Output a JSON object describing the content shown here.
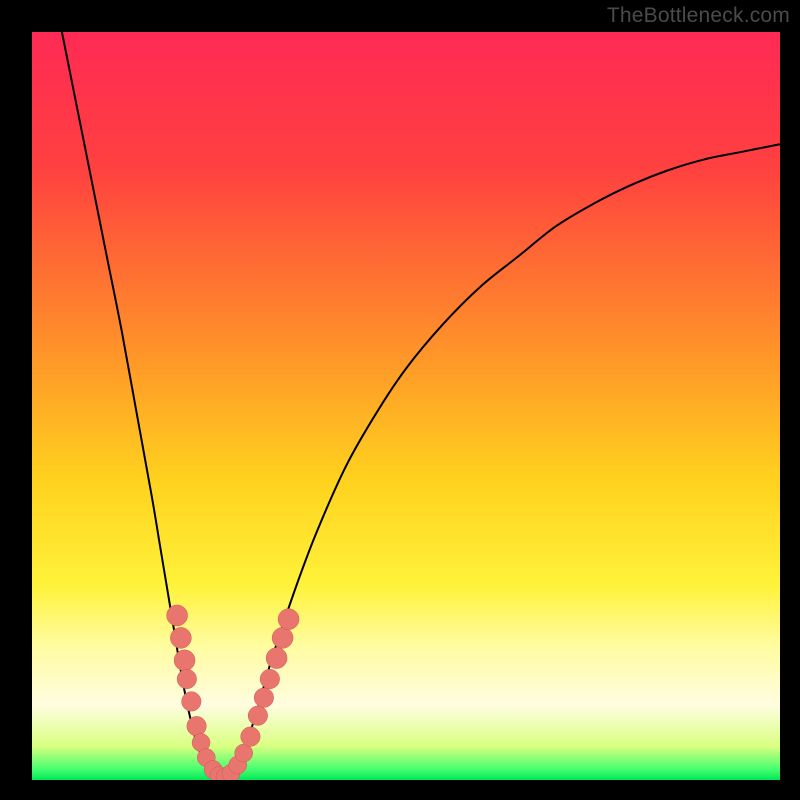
{
  "watermark": "TheBottleneck.com",
  "colors": {
    "frame": "#000000",
    "gradient_stops": [
      {
        "offset": 0.0,
        "color": "#ff2a55"
      },
      {
        "offset": 0.18,
        "color": "#ff4040"
      },
      {
        "offset": 0.4,
        "color": "#ff8a2b"
      },
      {
        "offset": 0.6,
        "color": "#ffd21e"
      },
      {
        "offset": 0.74,
        "color": "#fff23a"
      },
      {
        "offset": 0.82,
        "color": "#fffca0"
      },
      {
        "offset": 0.9,
        "color": "#fffde0"
      },
      {
        "offset": 0.955,
        "color": "#d9ff80"
      },
      {
        "offset": 0.985,
        "color": "#49ff70"
      },
      {
        "offset": 1.0,
        "color": "#00e858"
      }
    ],
    "curve": "#000000",
    "marker_fill": "#e8766f",
    "marker_stroke": "#d1574f"
  },
  "chart_data": {
    "type": "line",
    "title": "",
    "xlabel": "",
    "ylabel": "",
    "xlim": [
      0,
      100
    ],
    "ylim": [
      0,
      100
    ],
    "series": [
      {
        "name": "bottleneck-curve",
        "x": [
          4,
          6,
          8,
          10,
          12,
          14,
          16,
          17,
          18,
          19,
          20,
          21,
          22,
          23,
          24,
          25,
          26,
          27,
          28,
          30,
          32,
          35,
          38,
          42,
          46,
          50,
          55,
          60,
          65,
          70,
          75,
          80,
          85,
          90,
          95,
          100
        ],
        "y": [
          100,
          90,
          80,
          70,
          60,
          49,
          38,
          32,
          26,
          20,
          14,
          9,
          5,
          2.5,
          1,
          0.3,
          0.2,
          1,
          3,
          9,
          16,
          25,
          33,
          42,
          49,
          55,
          61,
          66,
          70,
          74,
          77,
          79.5,
          81.5,
          83,
          84,
          85
        ]
      }
    ],
    "markers": {
      "name": "highlight-points",
      "points": [
        {
          "x": 19.4,
          "y": 22,
          "r": 1.4
        },
        {
          "x": 19.9,
          "y": 19,
          "r": 1.4
        },
        {
          "x": 20.4,
          "y": 16,
          "r": 1.4
        },
        {
          "x": 20.7,
          "y": 13.5,
          "r": 1.3
        },
        {
          "x": 21.3,
          "y": 10.5,
          "r": 1.3
        },
        {
          "x": 22.0,
          "y": 7.2,
          "r": 1.3
        },
        {
          "x": 22.6,
          "y": 5.0,
          "r": 1.2
        },
        {
          "x": 23.3,
          "y": 3.0,
          "r": 1.2
        },
        {
          "x": 24.2,
          "y": 1.4,
          "r": 1.2
        },
        {
          "x": 25.0,
          "y": 0.6,
          "r": 1.2
        },
        {
          "x": 25.8,
          "y": 0.4,
          "r": 1.2
        },
        {
          "x": 26.6,
          "y": 0.9,
          "r": 1.2
        },
        {
          "x": 27.5,
          "y": 2.0,
          "r": 1.2
        },
        {
          "x": 28.3,
          "y": 3.6,
          "r": 1.2
        },
        {
          "x": 29.2,
          "y": 5.8,
          "r": 1.3
        },
        {
          "x": 30.2,
          "y": 8.6,
          "r": 1.3
        },
        {
          "x": 31.0,
          "y": 11.0,
          "r": 1.3
        },
        {
          "x": 31.8,
          "y": 13.5,
          "r": 1.3
        },
        {
          "x": 32.7,
          "y": 16.3,
          "r": 1.4
        },
        {
          "x": 33.5,
          "y": 19.0,
          "r": 1.4
        },
        {
          "x": 34.3,
          "y": 21.5,
          "r": 1.4
        }
      ]
    }
  }
}
